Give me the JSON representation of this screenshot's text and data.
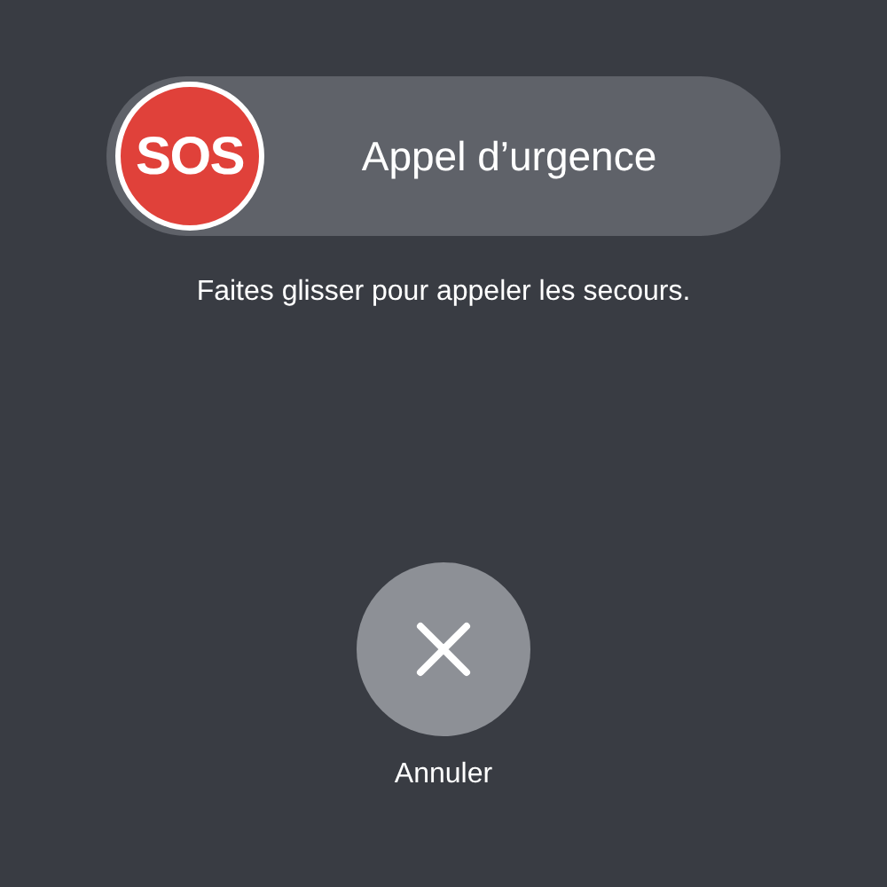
{
  "sos_slider": {
    "thumb_label": "SOS",
    "label": "Appel d’urgence",
    "level": 0
  },
  "hint": "Faites glisser pour appeler les secours.",
  "cancel": {
    "label": "Annuler"
  }
}
